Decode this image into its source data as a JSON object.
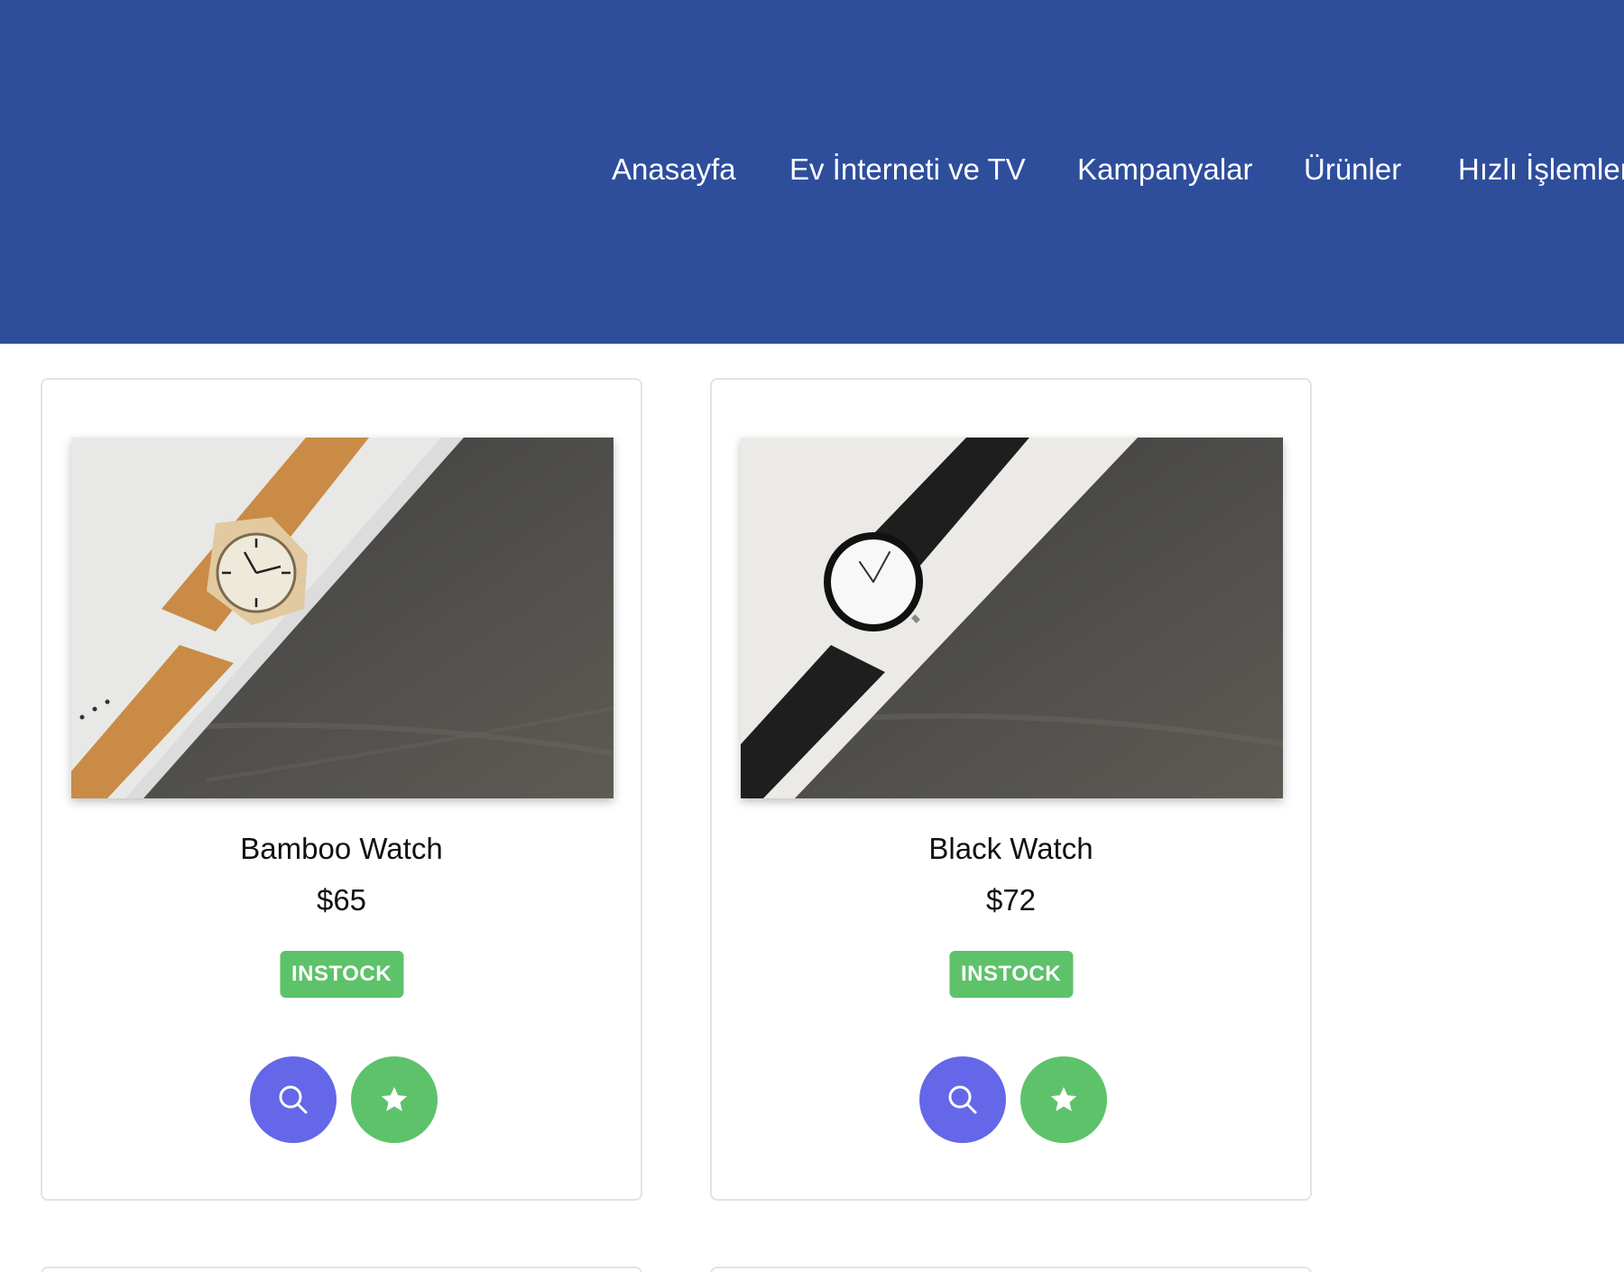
{
  "nav": {
    "items": [
      "Anasayfa",
      "Ev İnterneti ve TV",
      "Kampanyalar",
      "Ürünler",
      "Hızlı İşlemler"
    ]
  },
  "products": [
    {
      "name": "Bamboo Watch",
      "price": "$65",
      "status": "INSTOCK",
      "image": "bamboo-watch"
    },
    {
      "name": "Black Watch",
      "price": "$72",
      "status": "INSTOCK",
      "image": "black-watch"
    }
  ],
  "colors": {
    "header": "#2e4e9c",
    "instock": "#5ec26a",
    "search_button": "#6467e8",
    "favorite_button": "#5ec26a"
  },
  "icons": {
    "search": "search-icon",
    "favorite": "star-icon"
  }
}
